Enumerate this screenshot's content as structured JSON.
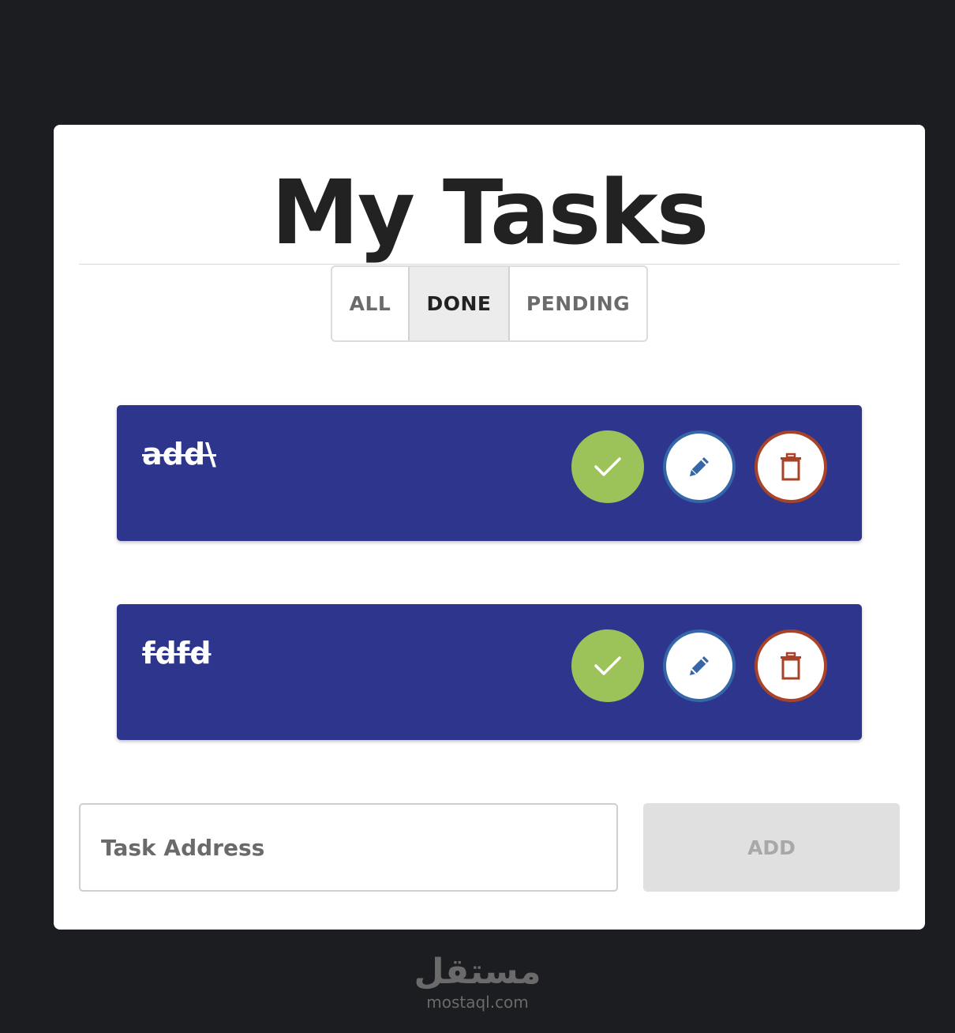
{
  "header": {
    "title": "My Tasks"
  },
  "filters": {
    "all_label": "ALL",
    "done_label": "DONE",
    "pending_label": "PENDING",
    "selected": "DONE"
  },
  "tasks": [
    {
      "text": "add\\",
      "completed": true
    },
    {
      "text": "fdfd",
      "completed": true
    }
  ],
  "task_actions": {
    "done_icon": "check-icon",
    "edit_icon": "pencil-icon",
    "delete_icon": "trash-icon"
  },
  "form": {
    "input_placeholder": "Task Address",
    "input_value": "",
    "add_label": "ADD"
  },
  "watermark": {
    "arabic": "مستقل",
    "latin": "mostaql.com"
  },
  "colors": {
    "background": "#1c1d20",
    "card": "#ffffff",
    "task_bg": "#2d358c",
    "done_green": "#9cc25a",
    "edit_blue": "#3466a8",
    "delete_red": "#a8432a"
  }
}
